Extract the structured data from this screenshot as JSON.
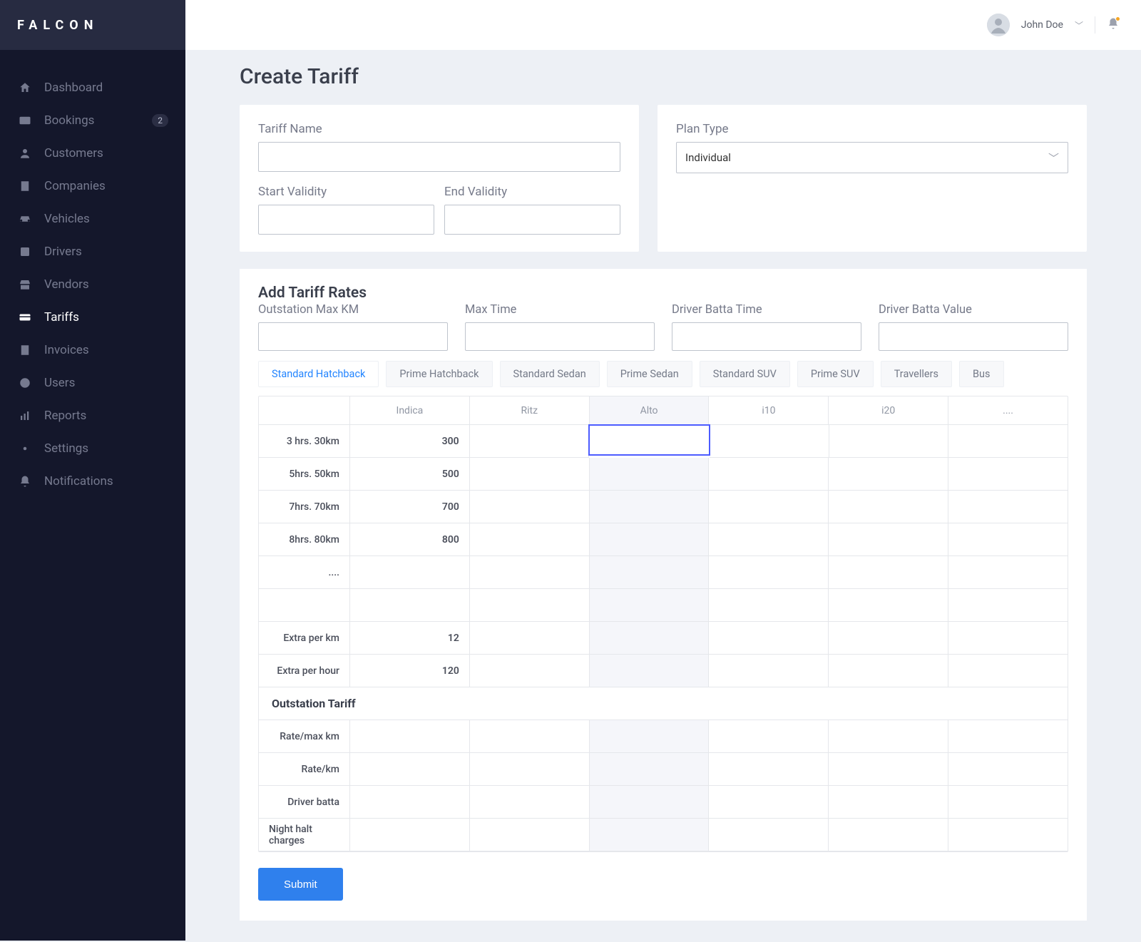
{
  "brand": "FALCON",
  "user": {
    "name": "John Doe"
  },
  "sidebar": {
    "items": [
      {
        "label": "Dashboard"
      },
      {
        "label": "Bookings",
        "badge": "2"
      },
      {
        "label": "Customers"
      },
      {
        "label": "Companies"
      },
      {
        "label": "Vehicles"
      },
      {
        "label": "Drivers"
      },
      {
        "label": "Vendors"
      },
      {
        "label": "Tariffs"
      },
      {
        "label": "Invoices"
      },
      {
        "label": "Users"
      },
      {
        "label": "Reports"
      },
      {
        "label": "Settings"
      },
      {
        "label": "Notifications"
      }
    ]
  },
  "page": {
    "title": "Create Tariff",
    "form": {
      "tariff_name_label": "Tariff Name",
      "start_validity_label": "Start Validity",
      "end_validity_label": "End Validity",
      "plan_type_label": "Plan Type",
      "plan_type_value": "Individual"
    },
    "rates": {
      "title": "Add Tariff Rates",
      "inputs": {
        "outstation_km": "Outstation Max KM",
        "max_time": "Max Time",
        "batta_time": "Driver Batta Time",
        "batta_value": "Driver Batta Value"
      },
      "tabs": [
        "Standard Hatchback",
        "Prime Hatchback",
        "Standard Sedan",
        "Prime Sedan",
        "Standard SUV",
        "Prime SUV",
        "Travellers",
        "Bus"
      ],
      "columns": [
        "Indica",
        "Ritz",
        "Alto",
        "i10",
        "i20",
        "...."
      ],
      "rows": [
        {
          "label": "3 hrs. 30km",
          "values": [
            "300",
            "",
            "",
            "",
            "",
            ""
          ]
        },
        {
          "label": "5hrs. 50km",
          "values": [
            "500",
            "",
            "",
            "",
            "",
            ""
          ]
        },
        {
          "label": "7hrs. 70km",
          "values": [
            "700",
            "",
            "",
            "",
            "",
            ""
          ]
        },
        {
          "label": "8hrs. 80km",
          "values": [
            "800",
            "",
            "",
            "",
            "",
            ""
          ]
        },
        {
          "label": "....",
          "values": [
            "",
            "",
            "",
            "",
            "",
            ""
          ]
        },
        {
          "label": "",
          "values": [
            "",
            "",
            "",
            "",
            "",
            ""
          ]
        },
        {
          "label": "Extra per km",
          "values": [
            "12",
            "",
            "",
            "",
            "",
            ""
          ]
        },
        {
          "label": "Extra per hour",
          "values": [
            "120",
            "",
            "",
            "",
            "",
            ""
          ]
        }
      ],
      "outstation_title": "Outstation Tariff",
      "outstation_rows": [
        {
          "label": "Rate/max km"
        },
        {
          "label": "Rate/km"
        },
        {
          "label": "Driver batta"
        },
        {
          "label": "Night halt charges"
        }
      ],
      "submit_label": "Submit"
    }
  }
}
